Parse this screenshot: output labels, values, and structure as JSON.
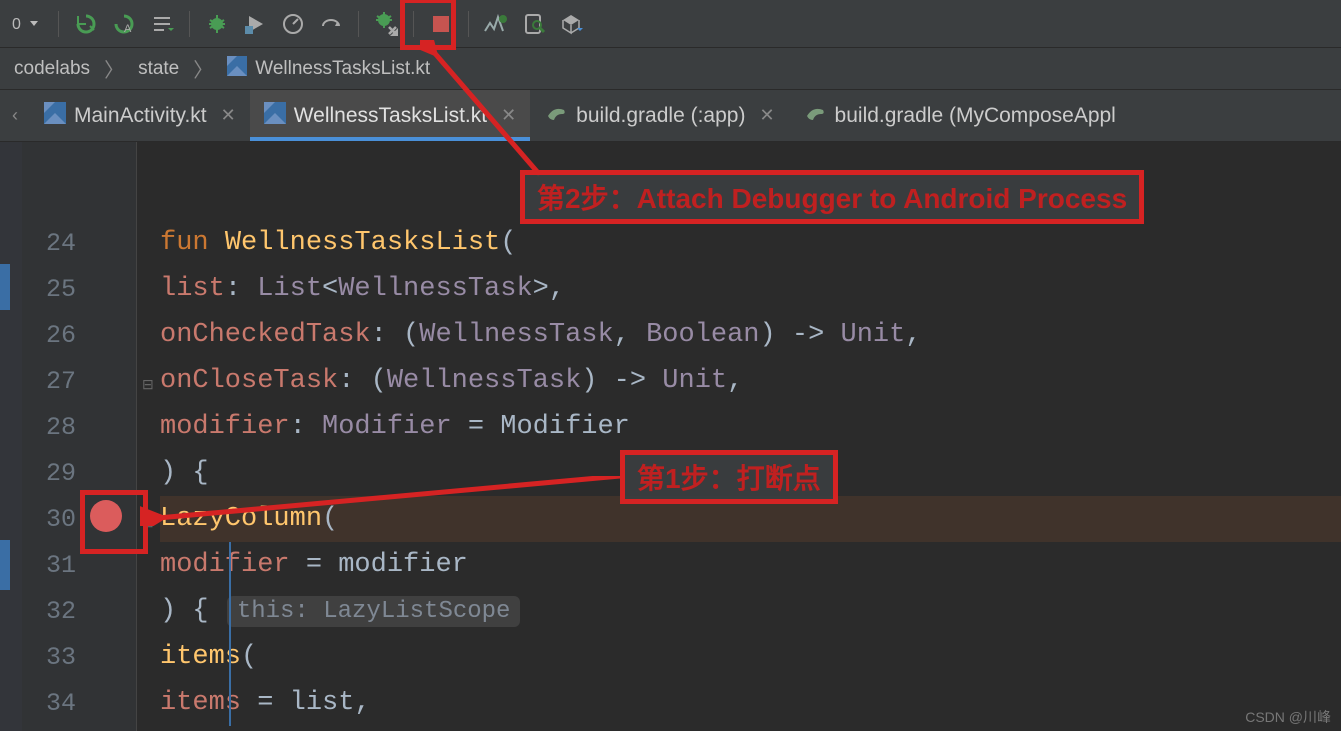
{
  "breadcrumbs": {
    "path1": "codelabs",
    "path2": "state",
    "file": "WellnessTasksList.kt"
  },
  "tabs": [
    {
      "name": "MainActivity.kt",
      "active": false,
      "icon": "kotlin"
    },
    {
      "name": "WellnessTasksList.kt",
      "active": true,
      "icon": "kotlin"
    },
    {
      "name": "build.gradle (:app)",
      "active": false,
      "icon": "gradle"
    },
    {
      "name": "build.gradle (MyComposeAppl",
      "active": false,
      "icon": "gradle"
    }
  ],
  "annotations": {
    "step1": "第1步：打断点",
    "step2": "第2步：Attach Debugger to Android Process"
  },
  "code": {
    "line24": {
      "kw": "fun ",
      "fn": "WellnessTasksList",
      "p": "("
    },
    "line25": {
      "par": "list",
      "op": ": ",
      "ty1": "List",
      "lt": "<",
      "ty2": "WellnessTask",
      "gt": ">",
      "c": ","
    },
    "line26": {
      "par": "onCheckedTask",
      "op": ": (",
      "ty1": "WellnessTask",
      "c1": ", ",
      "ty2": "Boolean",
      "cp": ") -> ",
      "ty3": "Unit",
      "c2": ","
    },
    "line27": {
      "par": "onCloseTask",
      "op": ": (",
      "ty1": "WellnessTask",
      "cp": ") -> ",
      "ty2": "Unit",
      "c": ","
    },
    "line28": {
      "par": "modifier",
      "op": ": ",
      "ty": "Modifier",
      "eq": " = ",
      "val": "Modifier"
    },
    "line29": {
      "text": ") {"
    },
    "line30": {
      "fn": "LazyColumn",
      "p": "("
    },
    "line31": {
      "par": "modifier",
      "eq": " = ",
      "val": "modifier"
    },
    "line32": {
      "cp": ") { ",
      "hint": "this: LazyListScope"
    },
    "line33": {
      "fn": "items",
      "p": "("
    },
    "line34": {
      "par": "items",
      "eq": " = ",
      "val": "list",
      "c": ","
    }
  },
  "line_numbers": [
    "24",
    "25",
    "26",
    "27",
    "28",
    "29",
    "30",
    "31",
    "32",
    "33",
    "34"
  ],
  "watermark": "CSDN @川峰"
}
